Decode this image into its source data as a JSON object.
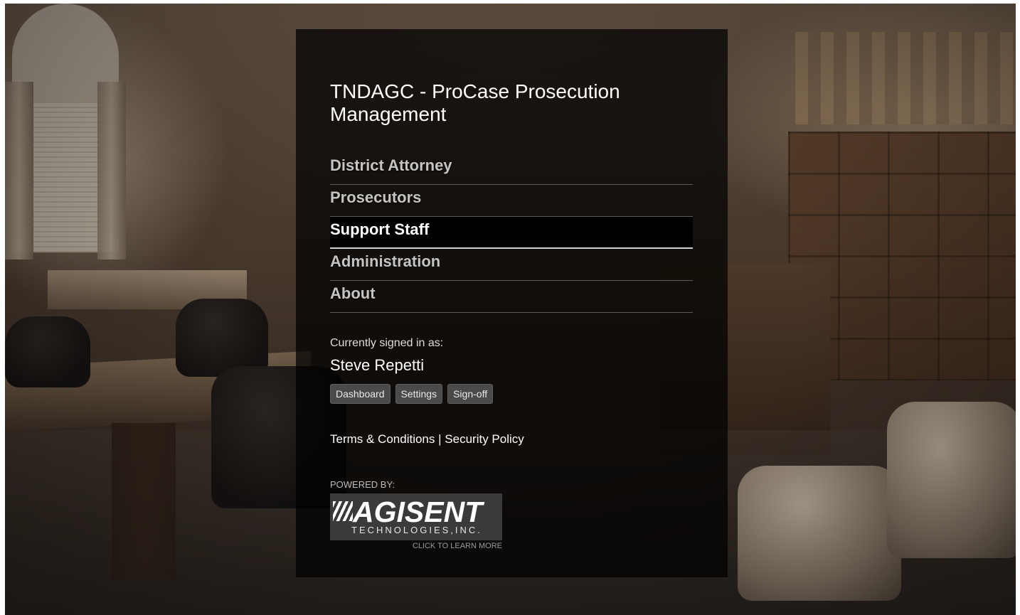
{
  "app": {
    "title": "TNDAGC - ProCase Prosecution Management"
  },
  "nav": {
    "items": [
      {
        "label": "District Attorney",
        "active": false
      },
      {
        "label": "Prosecutors",
        "active": false
      },
      {
        "label": "Support Staff",
        "active": true
      },
      {
        "label": "Administration",
        "active": false
      },
      {
        "label": "About",
        "active": false
      }
    ]
  },
  "user": {
    "signed_in_label": "Currently signed in as:",
    "name": "Steve Repetti",
    "buttons": {
      "dashboard": "Dashboard",
      "settings": "Settings",
      "signoff": "Sign-off"
    }
  },
  "footer": {
    "terms": "Terms & Conditions",
    "separator": "|",
    "security": "Security Policy",
    "powered_by": "POWERED BY:",
    "logo_main": "AGISENT",
    "logo_sub": "TECHNOLOGIES,INC.",
    "learn_more": "CLICK TO LEARN MORE"
  },
  "background": {
    "description_icon": "courtroom-photo"
  },
  "colors": {
    "panel_bg": "#000000",
    "active_item": "#ffffff",
    "inactive_item": "#c4c4c4",
    "button_bg": "#4a4a4a"
  }
}
